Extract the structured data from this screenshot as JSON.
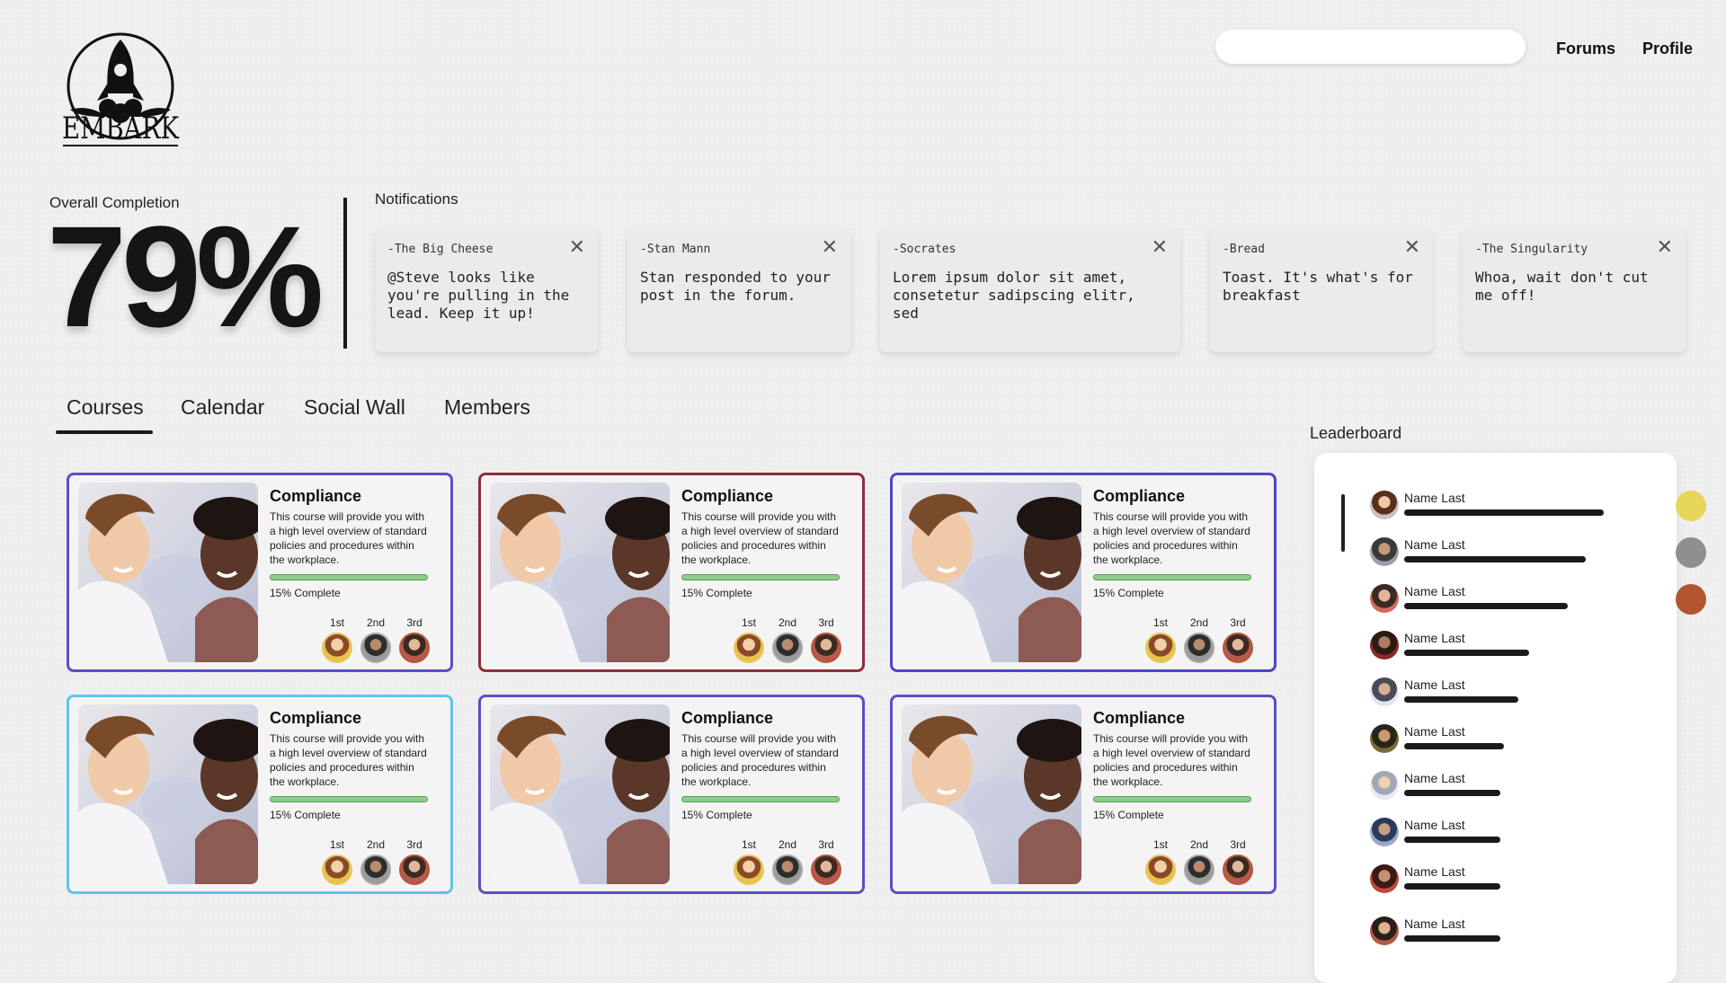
{
  "header": {
    "brand": "EMBARK",
    "search_placeholder": "",
    "nav": [
      {
        "label": "Forums"
      },
      {
        "label": "Profile"
      }
    ]
  },
  "completion": {
    "label": "Overall Completion",
    "value": "79%"
  },
  "notifications": {
    "label": "Notifications",
    "items": [
      {
        "author": "-The Big Cheese",
        "message": "@Steve looks like you're pulling in the lead. Keep it up!"
      },
      {
        "author": "-Stan Mann",
        "message": "Stan responded to your post in the forum."
      },
      {
        "author": "-Socrates",
        "message": "Lorem ipsum dolor sit amet, consetetur sadipscing elitr, sed"
      },
      {
        "author": "-Bread",
        "message": "Toast. It's what's for breakfast"
      },
      {
        "author": "-The Singularity",
        "message": "Whoa, wait don't cut me off!"
      }
    ]
  },
  "tabs": [
    {
      "label": "Courses",
      "active": true
    },
    {
      "label": "Calendar"
    },
    {
      "label": "Social Wall"
    },
    {
      "label": "Members"
    }
  ],
  "courses": [
    {
      "title": "Compliance",
      "description": "This course will provide you with a high level overview of standard policies and procedures within the workplace.",
      "progress_text": "15% Complete",
      "progress": 0.15,
      "border": "#5b4fc4"
    },
    {
      "title": "Compliance",
      "description": "This course will provide you with a high level overview of standard policies and procedures within the workplace.",
      "progress_text": "15% Complete",
      "progress": 0.15,
      "border": "#8a2f38"
    },
    {
      "title": "Compliance",
      "description": "This course will provide you with a high level overview of standard policies and procedures within the workplace.",
      "progress_text": "15% Complete",
      "progress": 0.15,
      "border": "#4f46c2"
    },
    {
      "title": "Compliance",
      "description": "This course will provide you with a high level overview of standard policies and procedures within the workplace.",
      "progress_text": "15% Complete",
      "progress": 0.15,
      "border": "#5fc4ea"
    },
    {
      "title": "Compliance",
      "description": "This course will provide you with a high level overview of standard policies and procedures within the workplace.",
      "progress_text": "15% Complete",
      "progress": 0.15,
      "border": "#5b4fc4"
    },
    {
      "title": "Compliance",
      "description": "This course will provide you with a high level overview of standard policies and procedures within the workplace.",
      "progress_text": "15% Complete",
      "progress": 0.15,
      "border": "#5b4fc4"
    }
  ],
  "ranks": [
    "1st",
    "2nd",
    "3rd"
  ],
  "leaderboard": {
    "label": "Leaderboard",
    "entries": [
      {
        "name": "Name Last",
        "score": 0.56,
        "medal": "#e6d65a"
      },
      {
        "name": "Name Last",
        "score": 0.51,
        "medal": "#8f8f8f"
      },
      {
        "name": "Name Last",
        "score": 0.46,
        "medal": "#b2552e"
      },
      {
        "name": "Name Last",
        "score": 0.35
      },
      {
        "name": "Name Last",
        "score": 0.32
      },
      {
        "name": "Name Last",
        "score": 0.28
      },
      {
        "name": "Name Last",
        "score": 0.27
      },
      {
        "name": "Name Last",
        "score": 0.27
      },
      {
        "name": "Name Last",
        "score": 0.27
      },
      {
        "name": "Name Last",
        "score": 0.27
      }
    ]
  }
}
